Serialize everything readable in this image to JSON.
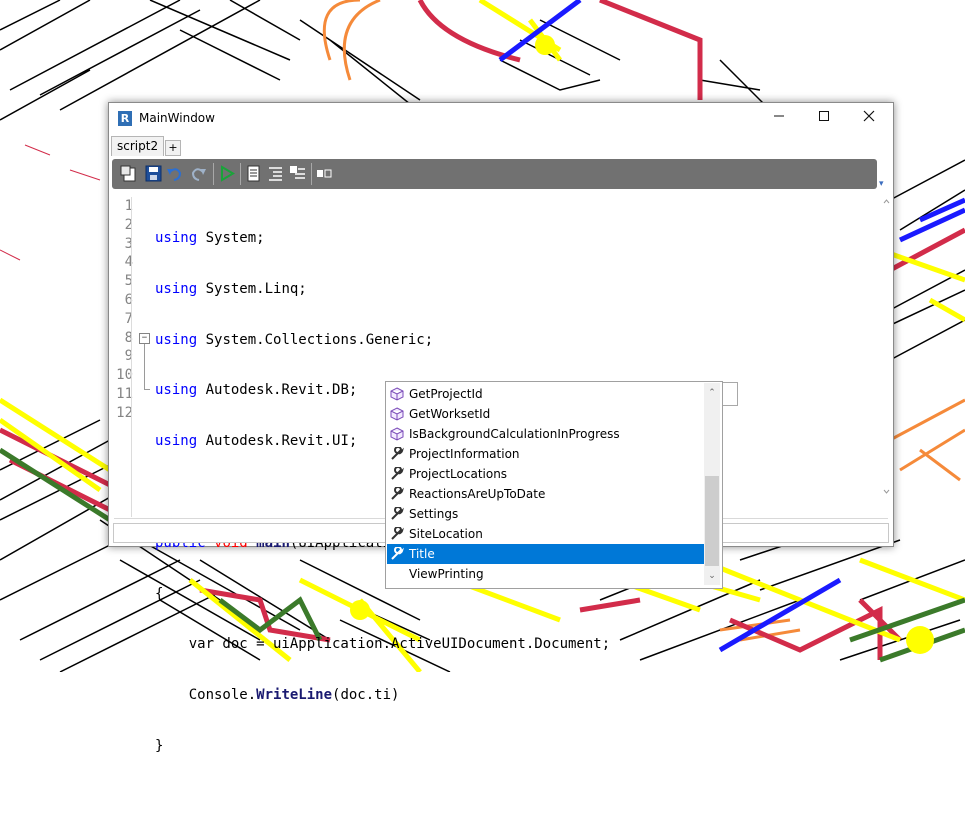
{
  "window": {
    "title": "MainWindow",
    "app_icon": "R"
  },
  "tabs": {
    "active": "script2",
    "add_label": "+"
  },
  "toolbar": {
    "icons": [
      "new-script-icon",
      "save-icon",
      "undo-icon",
      "redo-icon",
      "run-icon",
      "page-icon",
      "comment-lines-icon",
      "uncomment-lines-icon",
      "layout-toggle-icon"
    ]
  },
  "editor": {
    "line_numbers": [
      "1",
      "2",
      "3",
      "4",
      "5",
      "6",
      "7",
      "8",
      "9",
      "10",
      "11",
      "12"
    ],
    "lines": {
      "l1": {
        "kw": "using",
        "rest": " System;"
      },
      "l2": {
        "kw": "using",
        "rest": " System.Linq;"
      },
      "l3": {
        "kw": "using",
        "rest": " System.Collections.Generic;"
      },
      "l4": {
        "kw": "using",
        "rest": " Autodesk.Revit.DB;"
      },
      "l5": {
        "kw": "using",
        "rest": " Autodesk.Revit.UI;"
      },
      "l7": {
        "kw1": "public",
        "kw2": "void",
        "fn": "main",
        "rest": "(UIApplication uiApplication)"
      },
      "l8": "{",
      "l9": "    var doc = uiApplication.ActiveUIDocument.Document;",
      "l10": {
        "pre": "    Console.",
        "fn": "WriteLine",
        "rest": "(doc.ti)"
      },
      "l11": "}"
    }
  },
  "autocomplete": {
    "items": [
      {
        "label": "GetProjectId",
        "icon": "method-cube-icon"
      },
      {
        "label": "GetWorksetId",
        "icon": "method-cube-icon"
      },
      {
        "label": "IsBackgroundCalculationInProgress",
        "icon": "method-cube-icon"
      },
      {
        "label": "ProjectInformation",
        "icon": "property-wrench-icon"
      },
      {
        "label": "ProjectLocations",
        "icon": "property-wrench-icon"
      },
      {
        "label": "ReactionsAreUpToDate",
        "icon": "property-wrench-icon"
      },
      {
        "label": "Settings",
        "icon": "property-wrench-icon"
      },
      {
        "label": "SiteLocation",
        "icon": "property-wrench-icon"
      },
      {
        "label": "Title",
        "icon": "property-wrench-icon"
      },
      {
        "label": "ViewPrinting",
        "icon": ""
      }
    ],
    "selected": "Title"
  },
  "colors": {
    "keyword": "#0000ff",
    "selection": "#0078d7",
    "toolbar": "#717171"
  }
}
